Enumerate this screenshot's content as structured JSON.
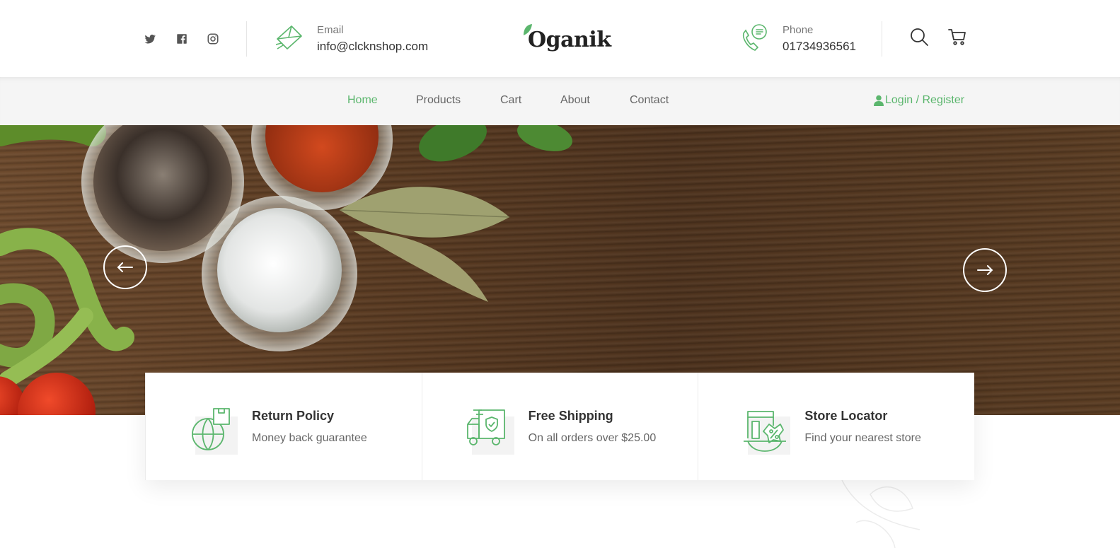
{
  "header": {
    "email": {
      "label": "Email",
      "value": "info@clcknshop.com",
      "icon": "envelope-icon"
    },
    "phone": {
      "label": "Phone",
      "value": "01734936561",
      "icon": "phone-icon"
    },
    "logo_text": "Oganik",
    "social": [
      "twitter-icon",
      "facebook-icon",
      "instagram-icon"
    ]
  },
  "nav": {
    "items": [
      {
        "label": "Home",
        "active": true
      },
      {
        "label": "Products",
        "active": false
      },
      {
        "label": "Cart",
        "active": false
      },
      {
        "label": "About",
        "active": false
      },
      {
        "label": "Contact",
        "active": false
      }
    ],
    "login_label": "Login / Register"
  },
  "features": [
    {
      "title": "Return Policy",
      "subtitle": "Money back guarantee",
      "icon": "globe-box-icon"
    },
    {
      "title": "Free Shipping",
      "subtitle": "On all orders over $25.00",
      "icon": "delivery-truck-icon"
    },
    {
      "title": "Store Locator",
      "subtitle": "Find your nearest store",
      "icon": "store-icon"
    }
  ],
  "colors": {
    "accent": "#5bb66d",
    "text": "#333333",
    "muted": "#666666"
  }
}
